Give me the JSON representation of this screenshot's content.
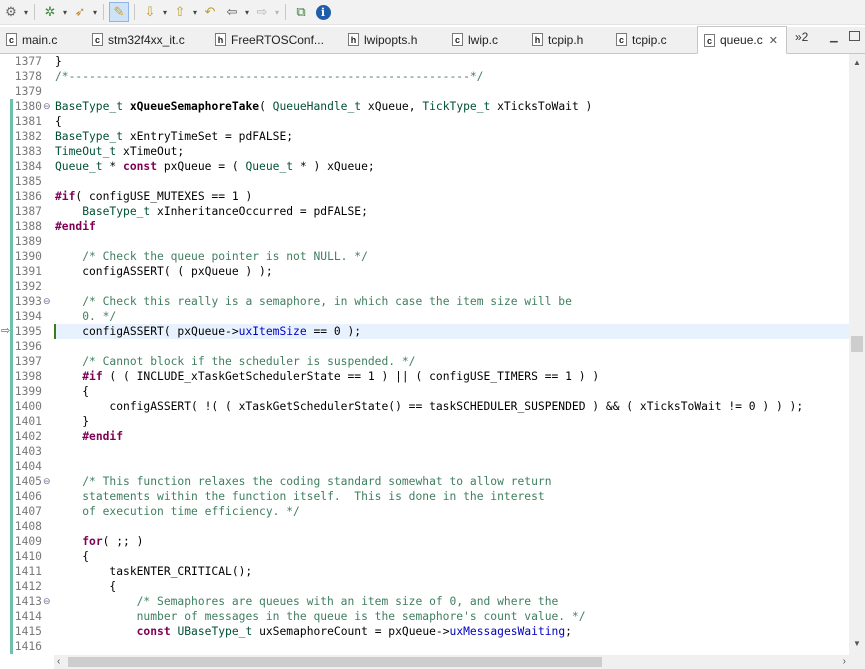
{
  "toolbar": {
    "icons": [
      "run-gear-icon",
      "debug-bug-icon",
      "external-tools-icon",
      "toggle-mark-occurrences-icon",
      "next-annotation-icon",
      "previous-annotation-icon",
      "last-edit-location-icon",
      "back-icon",
      "forward-icon",
      "new-window-icon",
      "info-icon"
    ]
  },
  "tabs": [
    {
      "label": "main.c",
      "type": "c"
    },
    {
      "label": "stm32f4xx_it.c",
      "type": "c"
    },
    {
      "label": "FreeRTOSConf...",
      "type": "h"
    },
    {
      "label": "lwipopts.h",
      "type": "h"
    },
    {
      "label": "lwip.c",
      "type": "c"
    },
    {
      "label": "tcpip.h",
      "type": "h"
    },
    {
      "label": "tcpip.c",
      "type": "c"
    },
    {
      "label": "queue.c",
      "type": "c",
      "active": true
    }
  ],
  "tab_overflow": "»2",
  "editor": {
    "current_line": "1395",
    "lines": [
      {
        "n": "1377",
        "html": "}"
      },
      {
        "n": "1378",
        "html": "<span class='t-cm'>/*-----------------------------------------------------------*/</span>"
      },
      {
        "n": "1379",
        "html": ""
      },
      {
        "n": "1380",
        "fold": true,
        "html": "<span class='t-type'>BaseType_t</span> <span class='t-fn'>xQueueSemaphoreTake</span>( <span class='t-type'>QueueHandle_t</span> xQueue, <span class='t-type'>TickType_t</span> xTicksToWait )"
      },
      {
        "n": "1381",
        "html": "{"
      },
      {
        "n": "1382",
        "html": "<span class='t-type'>BaseType_t</span> xEntryTimeSet = pdFALSE;"
      },
      {
        "n": "1383",
        "html": "<span class='t-type'>TimeOut_t</span> xTimeOut;"
      },
      {
        "n": "1384",
        "html": "<span class='t-type'>Queue_t</span> * <span class='t-kw'>const</span> pxQueue = ( <span class='t-type'>Queue_t</span> * ) xQueue;"
      },
      {
        "n": "1385",
        "html": ""
      },
      {
        "n": "1386",
        "html": "<span class='t-pp'>#if</span>( configUSE_MUTEXES == 1 )"
      },
      {
        "n": "1387",
        "html": "    <span class='t-type'>BaseType_t</span> xInheritanceOccurred = pdFALSE;"
      },
      {
        "n": "1388",
        "html": "<span class='t-pp'>#endif</span>"
      },
      {
        "n": "1389",
        "html": ""
      },
      {
        "n": "1390",
        "html": "    <span class='t-cm'>/* Check the queue pointer is not NULL. */</span>"
      },
      {
        "n": "1391",
        "html": "    configASSERT( ( pxQueue ) );"
      },
      {
        "n": "1392",
        "html": ""
      },
      {
        "n": "1393",
        "fold": true,
        "html": "    <span class='t-cm'>/* Check this really is a semaphore, in which case the item size will be</span>"
      },
      {
        "n": "1394",
        "html": "    <span class='t-cm'>0. */</span>"
      },
      {
        "n": "1395",
        "current": true,
        "html": "    configASSERT( pxQueue-&gt;<span class='t-fld'>uxItemSize</span> == 0 );"
      },
      {
        "n": "1396",
        "html": ""
      },
      {
        "n": "1397",
        "html": "    <span class='t-cm'>/* Cannot block if the scheduler is suspended. */</span>"
      },
      {
        "n": "1398",
        "html": "    <span class='t-pp'>#if</span> ( ( INCLUDE_xTaskGetSchedulerState == 1 ) || ( configUSE_TIMERS == 1 ) )"
      },
      {
        "n": "1399",
        "html": "    {"
      },
      {
        "n": "1400",
        "html": "        configASSERT( !( ( xTaskGetSchedulerState() == taskSCHEDULER_SUSPENDED ) &amp;&amp; ( xTicksToWait != 0 ) ) );"
      },
      {
        "n": "1401",
        "html": "    }"
      },
      {
        "n": "1402",
        "html": "    <span class='t-pp'>#endif</span>"
      },
      {
        "n": "1403",
        "html": ""
      },
      {
        "n": "1404",
        "html": ""
      },
      {
        "n": "1405",
        "fold": true,
        "html": "    <span class='t-cm'>/* This function relaxes the coding standard somewhat to allow return</span>"
      },
      {
        "n": "1406",
        "html": "    <span class='t-cm'>statements within the function itself.  This is done in the interest</span>"
      },
      {
        "n": "1407",
        "html": "    <span class='t-cm'>of execution time efficiency. */</span>"
      },
      {
        "n": "1408",
        "html": ""
      },
      {
        "n": "1409",
        "html": "    <span class='t-kw'>for</span>( ;; )"
      },
      {
        "n": "1410",
        "html": "    {"
      },
      {
        "n": "1411",
        "html": "        taskENTER_CRITICAL();"
      },
      {
        "n": "1412",
        "html": "        {"
      },
      {
        "n": "1413",
        "fold": true,
        "html": "            <span class='t-cm'>/* Semaphores are queues with an item size of 0, and where the</span>"
      },
      {
        "n": "1414",
        "html": "            <span class='t-cm'>number of messages in the queue is the semaphore's count value. */</span>"
      },
      {
        "n": "1415",
        "html": "            <span class='t-kw'>const</span> <span class='t-type'>UBaseType_t</span> uxSemaphoreCount = pxQueue-&gt;<span class='t-fld'>uxMessagesWaiting</span>;"
      },
      {
        "n": "1416",
        "html": ""
      }
    ]
  },
  "colors": {
    "coverage_bar": "#6dc0a9",
    "current_line": "#e8f2fe",
    "keyword": "#7f0055",
    "type": "#005032",
    "comment": "#3f7f5f",
    "field": "#0000c0"
  }
}
